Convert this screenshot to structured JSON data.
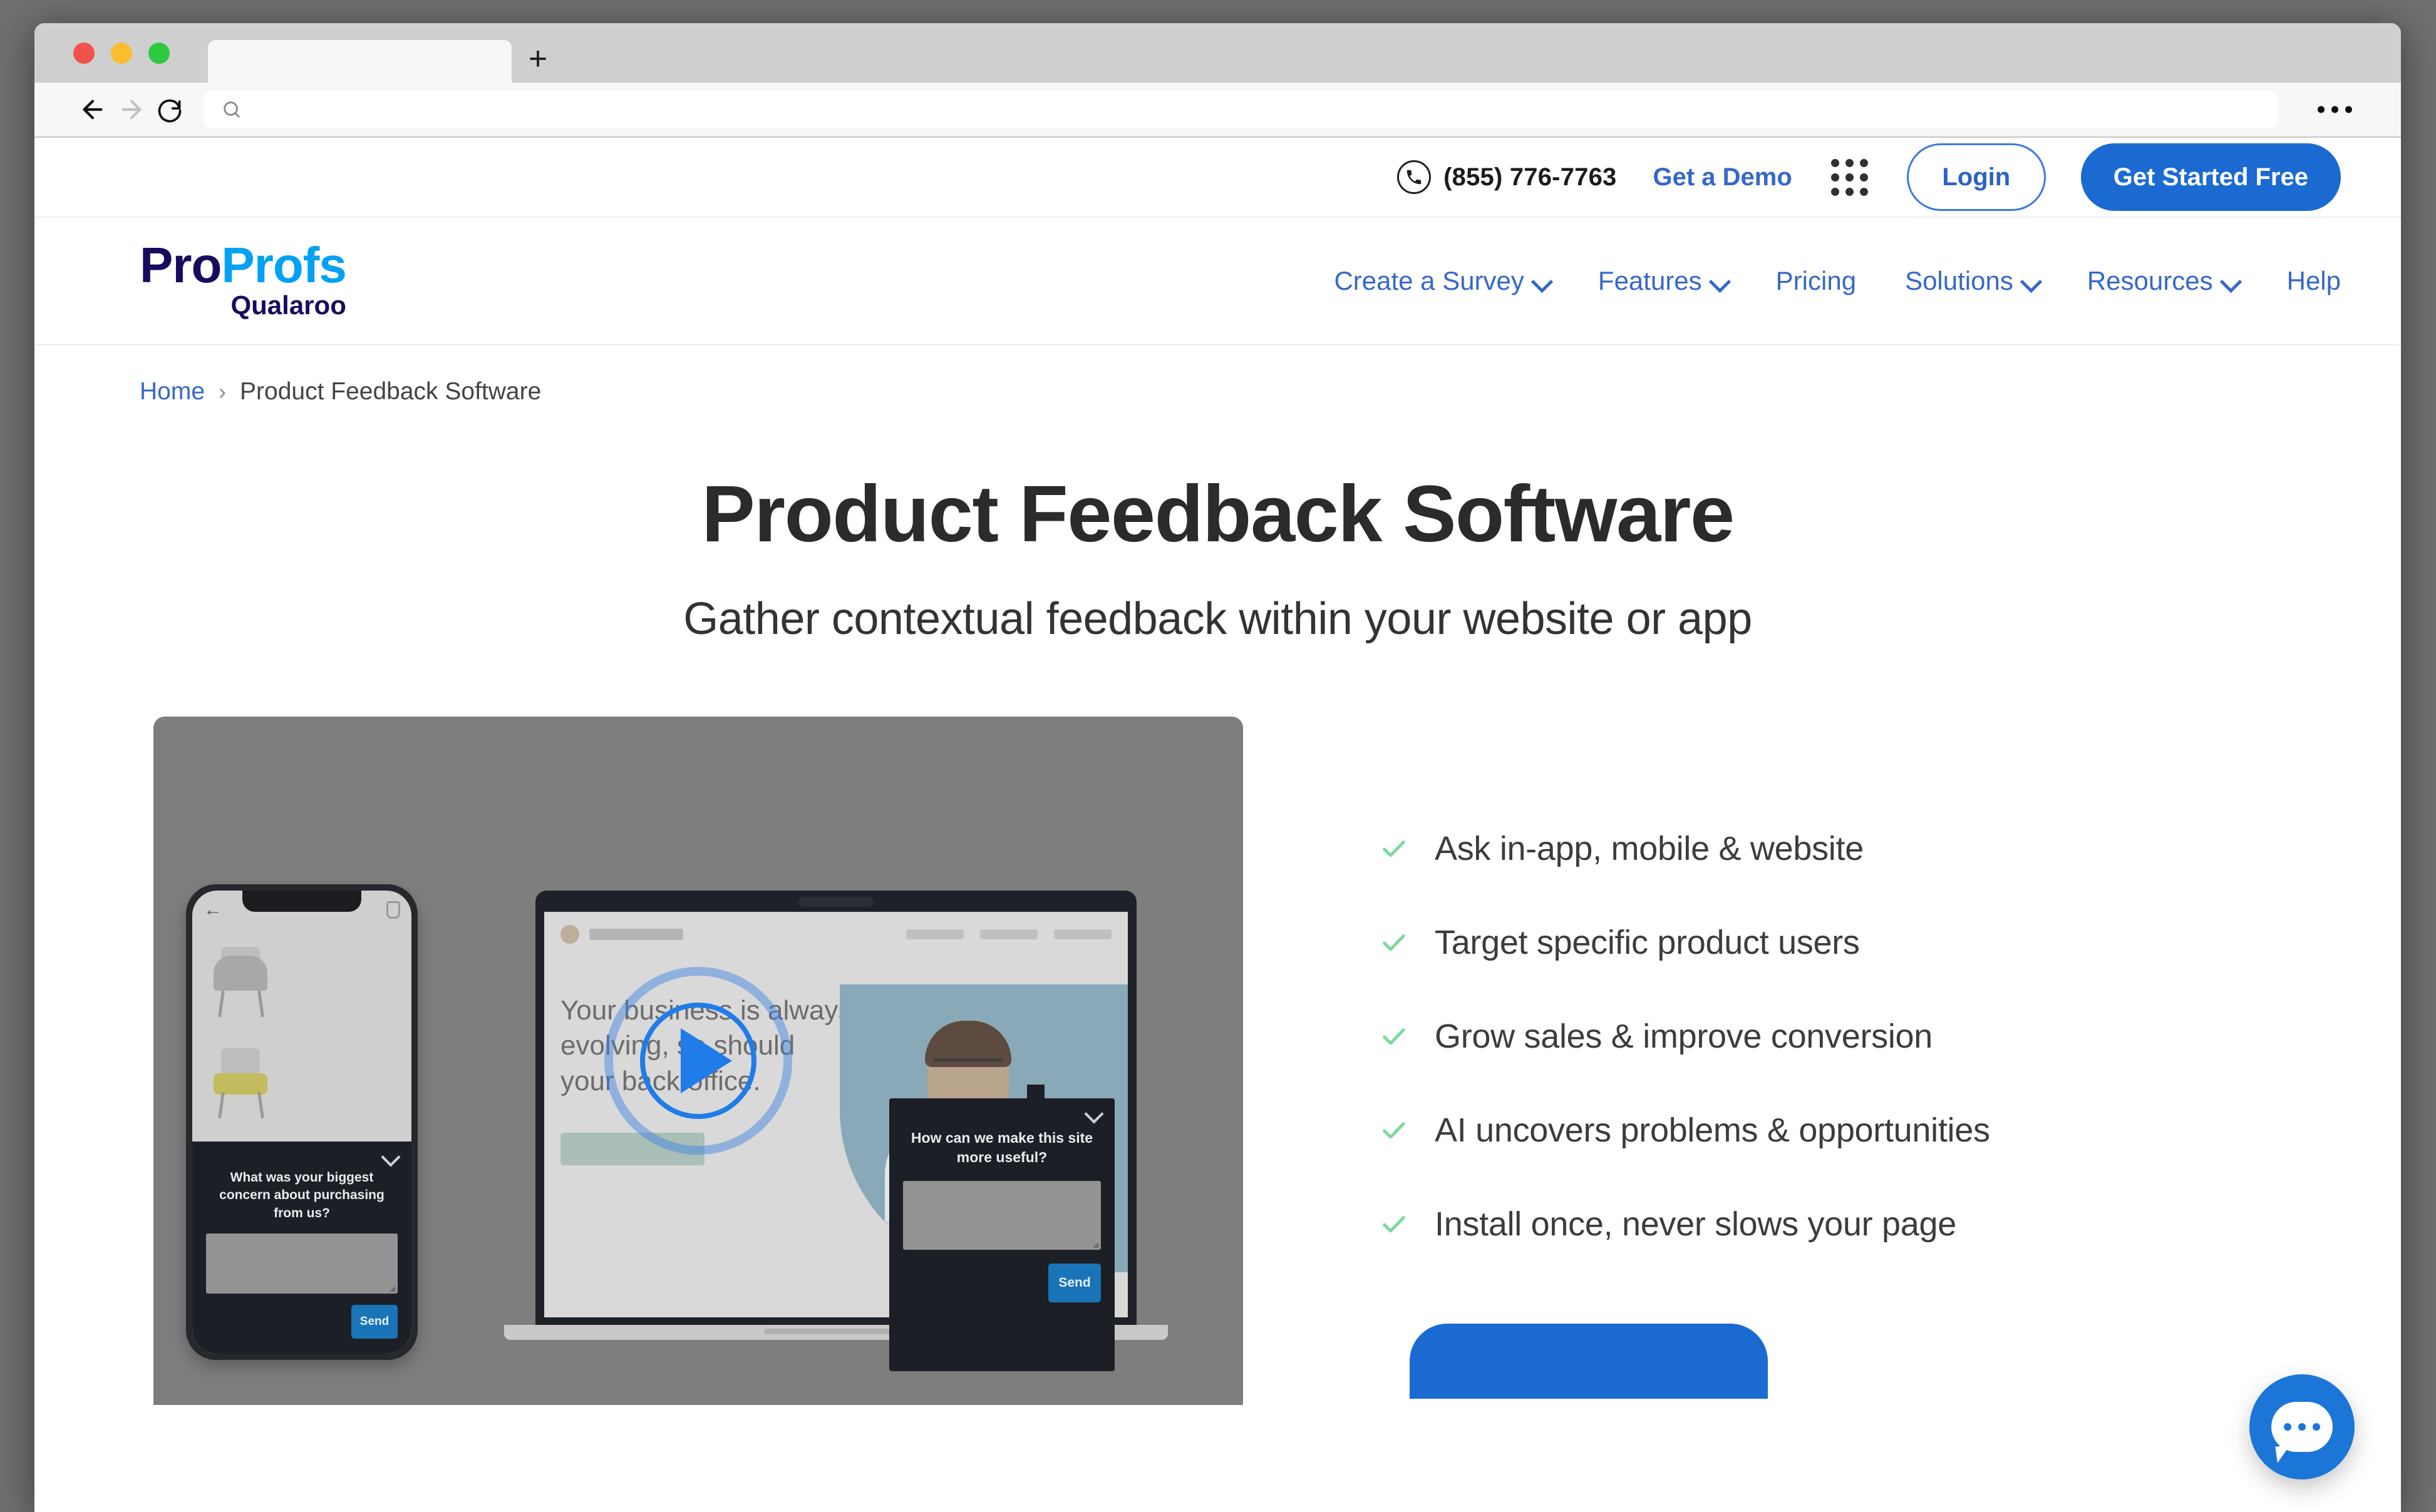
{
  "browser": {
    "tab_title": "",
    "url_value": "",
    "back_icon": "back-arrow-icon",
    "forward_icon": "forward-arrow-icon",
    "reload_icon": "reload-icon",
    "search_icon": "search-icon",
    "new_tab_icon": "plus-icon",
    "overflow_icon": "overflow-menu-icon"
  },
  "utility_bar": {
    "phone_icon": "phone-icon",
    "phone_number": "(855) 776-7763",
    "demo_link": "Get a Demo",
    "apps_icon": "apps-grid-icon",
    "login_label": "Login",
    "get_started_label": "Get Started Free"
  },
  "header": {
    "logo": {
      "part1": "Pro",
      "part2": "Profs",
      "sub": "Qualaroo"
    },
    "nav": [
      {
        "label": "Create a Survey",
        "has_dropdown": true
      },
      {
        "label": "Features",
        "has_dropdown": true
      },
      {
        "label": "Pricing",
        "has_dropdown": false
      },
      {
        "label": "Solutions",
        "has_dropdown": true
      },
      {
        "label": "Resources",
        "has_dropdown": true
      },
      {
        "label": "Help",
        "has_dropdown": false
      }
    ]
  },
  "breadcrumb": {
    "home": "Home",
    "separator": "›",
    "current": "Product Feedback Software"
  },
  "hero": {
    "title": "Product Feedback Software",
    "subtitle": "Gather contextual feedback within your website or app"
  },
  "video": {
    "play_icon": "play-button-icon",
    "phone_survey": {
      "question": "What was your biggest concern about purchasing from us?",
      "send_label": "Send",
      "collapse_icon": "chevron-down-icon"
    },
    "float_survey": {
      "question": "How can we make this site more useful?",
      "send_label": "Send",
      "collapse_icon": "chevron-down-icon"
    },
    "laptop_headline": "Your business is always evolving, so should your back office."
  },
  "features": {
    "check_color": "#7fd8a0",
    "items": [
      "Ask in-app, mobile & website",
      "Target specific product users",
      "Grow sales & improve conversion",
      "AI uncovers problems & opportunities",
      "Install once, never slows your page"
    ]
  },
  "cta": {
    "label": ""
  },
  "chat_widget": {
    "icon": "chat-bubble-icon"
  },
  "colors": {
    "primary_blue": "#1b6ad1",
    "link_blue": "#3668c8",
    "logo_navy": "#190a5e",
    "logo_cyan": "#00a1f4",
    "check_green": "#7fd8a0"
  }
}
